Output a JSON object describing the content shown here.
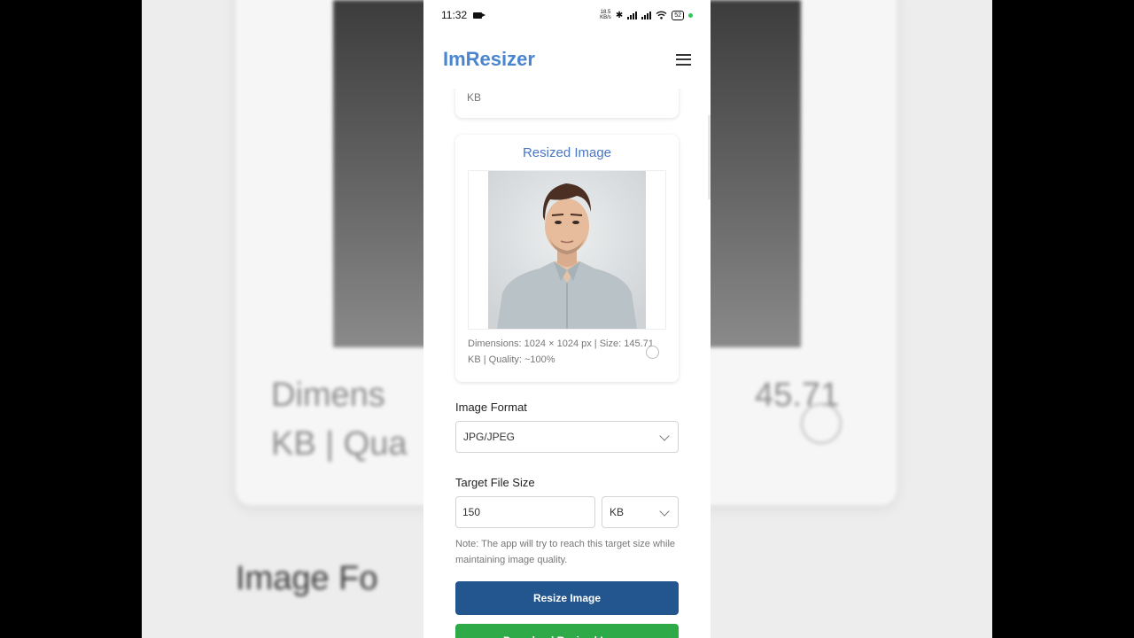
{
  "status_bar": {
    "time": "11:32",
    "net_speed_value": "18.5",
    "net_speed_unit": "KB/s",
    "battery": "52"
  },
  "app": {
    "brand": "ImResizer"
  },
  "previous_card": {
    "unit_text": "KB"
  },
  "resized_card": {
    "title": "Resized Image",
    "details": "Dimensions: 1024 × 1024 px | Size: 145.71 KB | Quality: ~100%"
  },
  "format": {
    "label": "Image Format",
    "selected": "JPG/JPEG"
  },
  "target_size": {
    "label": "Target File Size",
    "value": "150",
    "unit": "KB",
    "note": "Note: The app will try to reach this target size while maintaining image quality."
  },
  "buttons": {
    "resize": "Resize Image",
    "download": "Download Resized Image"
  },
  "background_blur": {
    "left_text_1": "Dimens",
    "left_text_2": "KB | Qua",
    "left_heading": "Image Fo",
    "right_text": "45.71"
  }
}
